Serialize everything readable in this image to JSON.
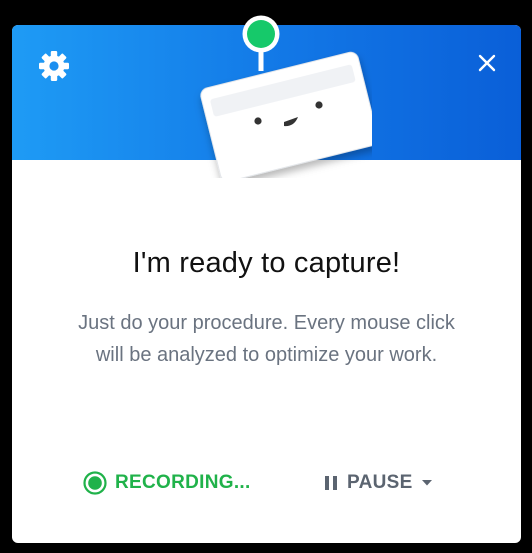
{
  "header": {
    "gradient_start": "#1e9bf5",
    "gradient_end": "#0a5fd8",
    "settings_icon": "gear-icon",
    "close_icon": "close-icon"
  },
  "mascot": {
    "icon": "robot-mascot",
    "antenna_color": "#16c96a"
  },
  "main": {
    "title": "I'm ready to capture!",
    "description": "Just do your procedure. Every mouse click will be analyzed to optimize your work."
  },
  "controls": {
    "recording_label": "RECORDING...",
    "recording_color": "#20b24a",
    "pause_label": "PAUSE",
    "pause_icon": "pause-icon",
    "dropdown_icon": "caret-down-icon"
  }
}
